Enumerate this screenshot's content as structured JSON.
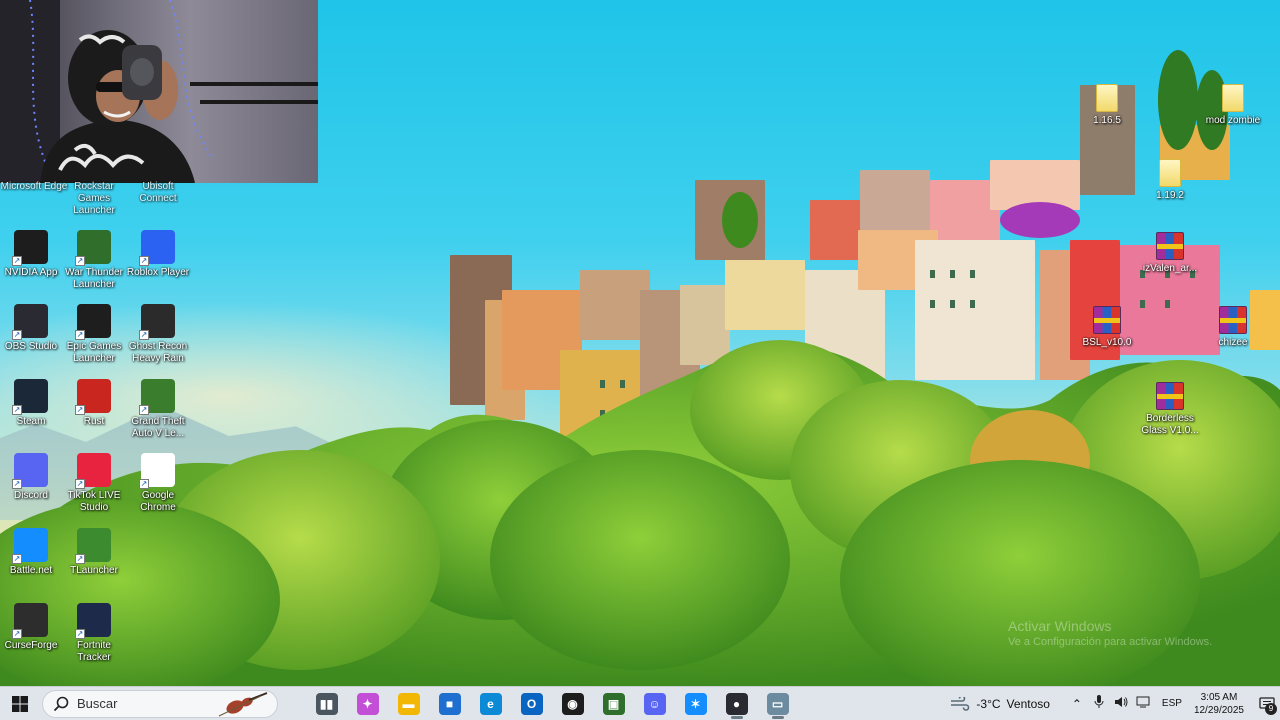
{
  "desktop_icons_left": [
    {
      "id": "nvidia",
      "label": "NVIDIA App",
      "icon": "nvidia-icon",
      "color": "#1d1d1d",
      "col": 0,
      "row": 0
    },
    {
      "id": "war-thunder",
      "label": "War Thunder Launcher",
      "icon": "war-thunder-icon",
      "color": "#2f6e2b",
      "col": 1,
      "row": 0
    },
    {
      "id": "roblox",
      "label": "Roblox Player",
      "icon": "roblox-icon",
      "color": "#2c62f2",
      "col": 2,
      "row": 0
    },
    {
      "id": "obs",
      "label": "OBS Studio",
      "icon": "obs-icon",
      "color": "#2a2a33",
      "col": 0,
      "row": 1
    },
    {
      "id": "epic",
      "label": "Epic Games Launcher",
      "icon": "epic-games-icon",
      "color": "#1e1e1e",
      "col": 1,
      "row": 1
    },
    {
      "id": "ghost-recon",
      "label": "Ghost Recon Heavy Rain",
      "icon": "skull-icon",
      "color": "#2b2b2b",
      "col": 2,
      "row": 1
    },
    {
      "id": "steam",
      "label": "Steam",
      "icon": "steam-icon",
      "color": "#1b2838",
      "col": 0,
      "row": 2
    },
    {
      "id": "rust",
      "label": "Rust",
      "icon": "rust-icon",
      "color": "#c8261f",
      "col": 1,
      "row": 2
    },
    {
      "id": "gta5",
      "label": "Grand Theft Auto V Le...",
      "icon": "gta-v-icon",
      "color": "#3a7d2c",
      "col": 2,
      "row": 2
    },
    {
      "id": "discord",
      "label": "Discord",
      "icon": "discord-icon",
      "color": "#5865f2",
      "col": 0,
      "row": 3
    },
    {
      "id": "tiktok",
      "label": "TikTok LIVE Studio",
      "icon": "tiktok-icon",
      "color": "#e8233f",
      "col": 1,
      "row": 3
    },
    {
      "id": "chrome",
      "label": "Google Chrome",
      "icon": "chrome-icon",
      "color": "#ffffff",
      "col": 2,
      "row": 3
    },
    {
      "id": "battlenet",
      "label": "Battle.net",
      "icon": "battle-net-icon",
      "color": "#148eff",
      "col": 0,
      "row": 4
    },
    {
      "id": "tlauncher",
      "label": "TLauncher",
      "icon": "tlauncher-icon",
      "color": "#3d8b2f",
      "col": 1,
      "row": 4
    },
    {
      "id": "curseforge",
      "label": "CurseForge",
      "icon": "curseforge-icon",
      "color": "#2d2d2d",
      "col": 0,
      "row": 5
    },
    {
      "id": "fortnite-tracker",
      "label": "Fortnite Tracker",
      "icon": "fortnite-tracker-icon",
      "color": "#1e2a4a",
      "col": 1,
      "row": 5
    }
  ],
  "desktop_icons_top_partial": [
    {
      "id": "edge-top",
      "label": "Microsoft Edge"
    },
    {
      "id": "rockstar-top",
      "label": "Rockstar Games Launcher"
    },
    {
      "id": "ubisoft-top",
      "label": "Ubisoft Connect"
    }
  ],
  "desktop_icons_right": [
    {
      "id": "f1165",
      "label": "1.16.5",
      "type": "folder"
    },
    {
      "id": "mod-zombie",
      "label": "mod zombie",
      "type": "folder"
    },
    {
      "id": "f1192",
      "label": "1.19.2",
      "type": "folder"
    },
    {
      "id": "izvalen",
      "label": "izValen_ar...",
      "type": "rar"
    },
    {
      "id": "bsl",
      "label": "BSL_v10.0",
      "type": "rar"
    },
    {
      "id": "chizee",
      "label": "chizee",
      "type": "rar"
    },
    {
      "id": "borderless",
      "label": "Borderless Glass V1.0...",
      "type": "rar"
    }
  ],
  "watermark": {
    "line1": "Activar Windows",
    "line2": "Ve a Configuración para activar Windows."
  },
  "taskbar": {
    "search_placeholder": "Buscar",
    "apps": [
      {
        "name": "task-view",
        "icon": "task-view-icon",
        "color": "#4a5560",
        "glyph": "▮▮"
      },
      {
        "name": "copilot",
        "icon": "copilot-icon",
        "color": "#c24fd6",
        "glyph": "✦"
      },
      {
        "name": "file-explorer",
        "icon": "folder-icon",
        "color": "#f2b705",
        "glyph": "▬"
      },
      {
        "name": "microsoft-store",
        "icon": "store-icon",
        "color": "#1f6fd1",
        "glyph": "■"
      },
      {
        "name": "edge",
        "icon": "edge-icon",
        "color": "#0c8ad6",
        "glyph": "e"
      },
      {
        "name": "outlook",
        "icon": "outlook-icon",
        "color": "#0a64c2",
        "glyph": "O"
      },
      {
        "name": "nvidia",
        "icon": "nvidia-icon",
        "color": "#1d1d1d",
        "glyph": "◉"
      },
      {
        "name": "war-thunder",
        "icon": "war-thunder-icon",
        "color": "#2f6e2b",
        "glyph": "▣"
      },
      {
        "name": "discord",
        "icon": "discord-icon",
        "color": "#5865f2",
        "glyph": "☺"
      },
      {
        "name": "battlenet",
        "icon": "battle-net-icon",
        "color": "#148eff",
        "glyph": "✶"
      },
      {
        "name": "obs",
        "icon": "obs-icon",
        "color": "#2a2a33",
        "glyph": "●"
      },
      {
        "name": "game-window",
        "icon": "window-icon",
        "color": "#6c8b9e",
        "glyph": "▭"
      }
    ],
    "weather_temp": "-3°C",
    "weather_text": "Ventoso",
    "language": "ESP",
    "time": "3:05 AM",
    "date": "12/29/2025",
    "notification_count": "9"
  },
  "colors": {
    "taskbar_bg": "#dfe5ea",
    "label_text": "#ffffff"
  }
}
